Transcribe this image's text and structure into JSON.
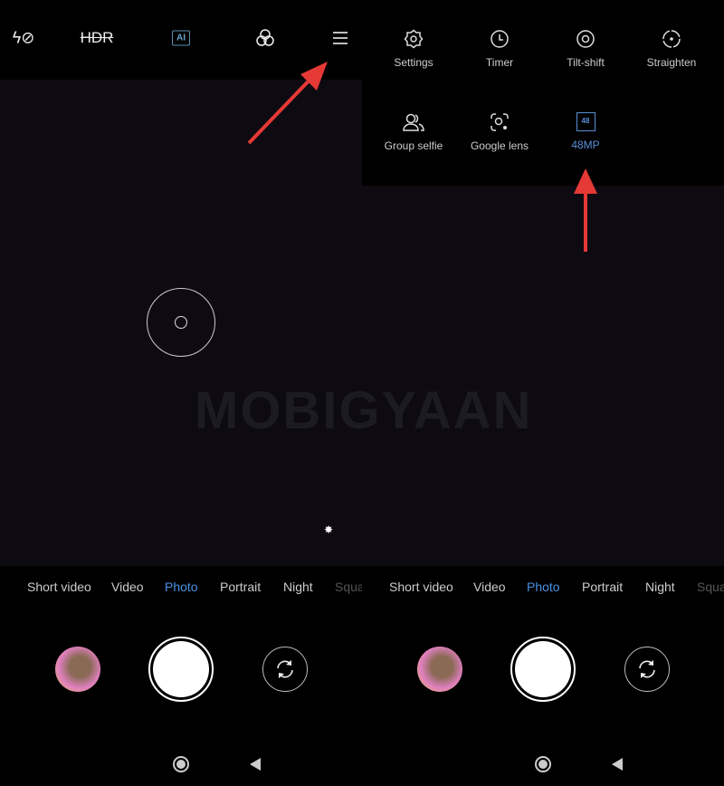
{
  "watermark": "MOBIGYAAN",
  "accent": "#4a90e2",
  "arrow_color": "#e53935",
  "left": {
    "topbar": [
      {
        "icon": "flash-off-icon",
        "label": "ϟ⊘"
      },
      {
        "icon": "hdr-off-icon",
        "label": "HDR"
      },
      {
        "icon": "ai-icon",
        "label": "AI"
      },
      {
        "icon": "filters-icon",
        "label": ""
      },
      {
        "icon": "menu-icon",
        "label": ""
      }
    ]
  },
  "right": {
    "menu": [
      {
        "icon": "settings-icon",
        "label": "Settings"
      },
      {
        "icon": "timer-icon",
        "label": "Timer"
      },
      {
        "icon": "tilt-shift-icon",
        "label": "Tilt-shift"
      },
      {
        "icon": "straighten-icon",
        "label": "Straighten"
      },
      {
        "icon": "group-selfie-icon",
        "label": "Group selfie"
      },
      {
        "icon": "google-lens-icon",
        "label": "Google lens"
      },
      {
        "icon": "48mp-icon",
        "label": "48MP",
        "badge": "48",
        "active": true
      }
    ]
  },
  "modes": [
    "Short video",
    "Video",
    "Photo",
    "Portrait",
    "Night",
    "Square"
  ],
  "active_mode": "Photo"
}
